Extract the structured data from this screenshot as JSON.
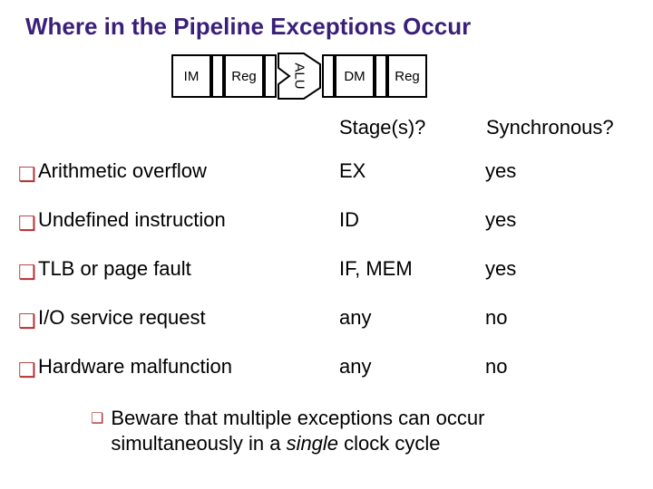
{
  "title": "Where in the Pipeline Exceptions Occur",
  "pipeline": {
    "im": "IM",
    "reg1": "Reg",
    "alu": "ALU",
    "dm": "DM",
    "reg2": "Reg"
  },
  "headers": {
    "stage": "Stage(s)?",
    "sync": "Synchronous?"
  },
  "rows": [
    {
      "name": "Arithmetic overflow",
      "stage": "EX",
      "sync": "yes"
    },
    {
      "name": "Undefined instruction",
      "stage": "ID",
      "sync": "yes"
    },
    {
      "name": "TLB or page fault",
      "stage": "IF, MEM",
      "sync": "yes"
    },
    {
      "name": "I/O service request",
      "stage": "any",
      "sync": "no"
    },
    {
      "name": "Hardware malfunction",
      "stage": "any",
      "sync": "no"
    }
  ],
  "note_pre": "Beware that multiple exceptions can occur simultaneously in a ",
  "note_italic": "single",
  "note_post": " clock cycle"
}
